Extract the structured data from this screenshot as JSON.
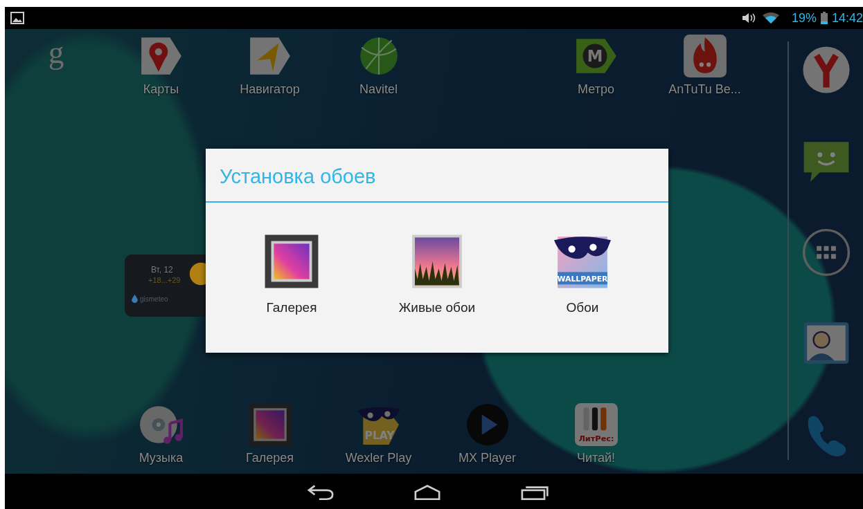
{
  "status_bar": {
    "battery": "19%",
    "time": "14:42"
  },
  "home": {
    "top_row": [
      {
        "kind": "google-search",
        "icon_text": "g"
      },
      {
        "kind": "maps",
        "label": "Карты"
      },
      {
        "kind": "navigator",
        "label": "Навигатор"
      },
      {
        "kind": "globe",
        "label": "Navitel"
      },
      {
        "kind": "empty"
      },
      {
        "kind": "metro",
        "label": "Метро",
        "icon_text": "M"
      },
      {
        "kind": "antutu",
        "label": "AnTuTu Be..."
      }
    ],
    "weather_widget": {
      "day": "Вт, 12",
      "temperature": "+18...+29",
      "brand": "gismeteo"
    },
    "bottom_row": [
      {
        "kind": "empty"
      },
      {
        "kind": "music",
        "label": "Музыка"
      },
      {
        "kind": "gallery",
        "label": "Галерея"
      },
      {
        "kind": "wexler",
        "label": "Wexler Play",
        "icon_text": "PLAY"
      },
      {
        "kind": "mx-player",
        "label": "MX Player"
      },
      {
        "kind": "litres",
        "label": "Читай!",
        "icon_text": "ЛитРес:"
      }
    ],
    "dock": [
      {
        "kind": "browser"
      },
      {
        "kind": "messaging"
      },
      {
        "kind": "app-drawer"
      },
      {
        "kind": "contacts"
      },
      {
        "kind": "phone"
      }
    ]
  },
  "dialog": {
    "title": "Установка обоев",
    "options": [
      {
        "kind": "gallery",
        "label": "Галерея"
      },
      {
        "kind": "live-wallpaper",
        "label": "Живые обои"
      },
      {
        "kind": "wallpaper",
        "label": "Обои",
        "icon_text": "WALLPAPER"
      }
    ]
  },
  "nav_bar": [
    {
      "kind": "back"
    },
    {
      "kind": "home"
    },
    {
      "kind": "recents"
    }
  ]
}
